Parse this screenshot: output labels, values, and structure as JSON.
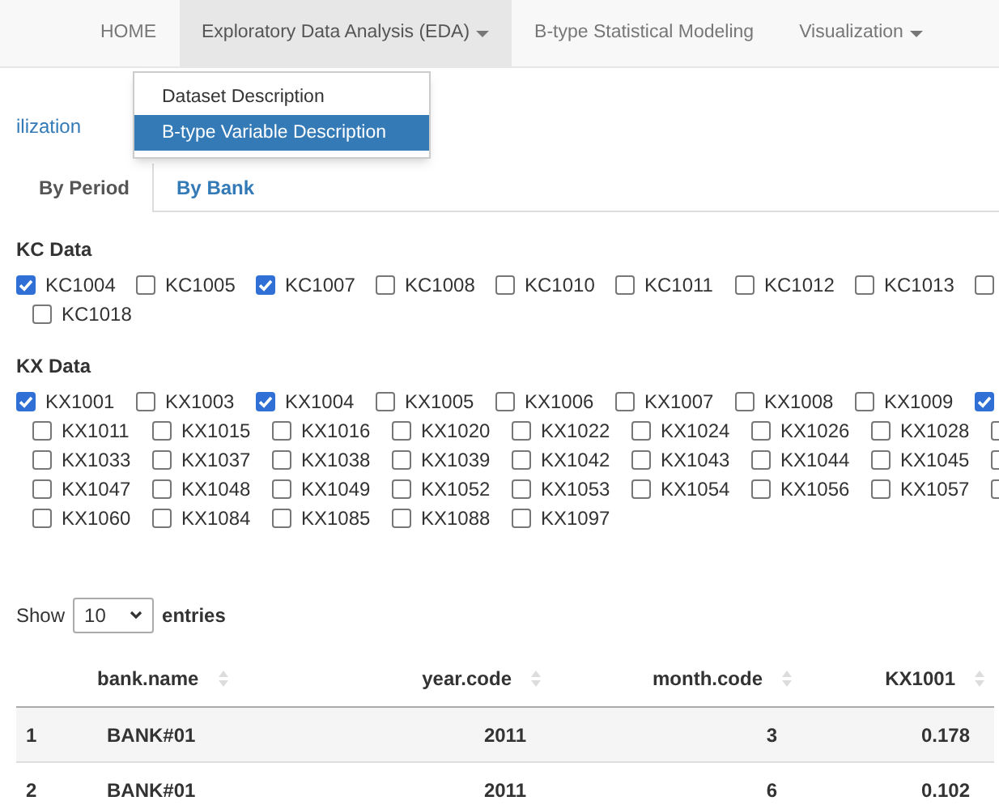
{
  "navbar": {
    "items": [
      {
        "label": "HOME",
        "dropdown": false,
        "selected": false
      },
      {
        "label": "Exploratory Data Analysis (EDA)",
        "dropdown": true,
        "selected": true
      },
      {
        "label": "B-type Statistical Modeling",
        "dropdown": false,
        "selected": false
      },
      {
        "label": "Visualization",
        "dropdown": true,
        "selected": false
      }
    ]
  },
  "dropdown_menu": {
    "items": [
      {
        "label": "Dataset Description",
        "selected": false
      },
      {
        "label": "B-type Variable Description",
        "selected": true
      }
    ]
  },
  "subnav": {
    "label": "ilization"
  },
  "tabs": [
    {
      "label": "By Period",
      "selected": true
    },
    {
      "label": "By Bank",
      "selected": false
    }
  ],
  "groups": [
    {
      "title": "KC Data",
      "options": [
        {
          "label": "KC1004",
          "checked": true
        },
        {
          "label": "KC1005",
          "checked": false
        },
        {
          "label": "KC1007",
          "checked": true
        },
        {
          "label": "KC1008",
          "checked": false
        },
        {
          "label": "KC1010",
          "checked": false
        },
        {
          "label": "KC1011",
          "checked": false
        },
        {
          "label": "KC1012",
          "checked": false
        },
        {
          "label": "KC1013",
          "checked": false
        },
        {
          "checked": false
        },
        {
          "label": "KC1018",
          "checked": false
        }
      ]
    },
    {
      "title": "KX Data",
      "options": [
        {
          "label": "KX1001",
          "checked": true
        },
        {
          "label": "KX1003",
          "checked": false
        },
        {
          "label": "KX1004",
          "checked": true
        },
        {
          "label": "KX1005",
          "checked": false
        },
        {
          "label": "KX1006",
          "checked": false
        },
        {
          "label": "KX1007",
          "checked": false
        },
        {
          "label": "KX1008",
          "checked": false
        },
        {
          "label": "KX1009",
          "checked": false
        },
        {
          "checked": true
        },
        {
          "label": "KX1011",
          "checked": false
        },
        {
          "label": "KX1015",
          "checked": false
        },
        {
          "label": "KX1016",
          "checked": false
        },
        {
          "label": "KX1020",
          "checked": false
        },
        {
          "label": "KX1022",
          "checked": false
        },
        {
          "label": "KX1024",
          "checked": false
        },
        {
          "label": "KX1026",
          "checked": false
        },
        {
          "label": "KX1028",
          "checked": false
        },
        {
          "checked": false
        },
        {
          "label": "KX1033",
          "checked": false
        },
        {
          "label": "KX1037",
          "checked": false
        },
        {
          "label": "KX1038",
          "checked": false
        },
        {
          "label": "KX1039",
          "checked": false
        },
        {
          "label": "KX1042",
          "checked": false
        },
        {
          "label": "KX1043",
          "checked": false
        },
        {
          "label": "KX1044",
          "checked": false
        },
        {
          "label": "KX1045",
          "checked": false
        },
        {
          "checked": false
        },
        {
          "label": "KX1047",
          "checked": false
        },
        {
          "label": "KX1048",
          "checked": false
        },
        {
          "label": "KX1049",
          "checked": false
        },
        {
          "label": "KX1052",
          "checked": false
        },
        {
          "label": "KX1053",
          "checked": false
        },
        {
          "label": "KX1054",
          "checked": false
        },
        {
          "label": "KX1056",
          "checked": false
        },
        {
          "label": "KX1057",
          "checked": false
        },
        {
          "checked": false
        },
        {
          "label": "KX1060",
          "checked": false
        },
        {
          "label": "KX1084",
          "checked": false
        },
        {
          "label": "KX1085",
          "checked": false
        },
        {
          "label": "KX1088",
          "checked": false
        },
        {
          "label": "KX1097",
          "checked": false
        }
      ]
    }
  ],
  "length_control": {
    "prefix": "Show",
    "value": "10",
    "suffix": "entries"
  },
  "table": {
    "columns": [
      {},
      {
        "label": "bank.name"
      },
      {
        "label": "year.code"
      },
      {
        "label": "month.code"
      },
      {
        "label": "KX1001"
      }
    ],
    "rows": [
      [
        "1",
        "BANK#01",
        "2011",
        "3",
        "0.178"
      ],
      [
        "2",
        "BANK#01",
        "2011",
        "6",
        "0.102"
      ]
    ]
  }
}
